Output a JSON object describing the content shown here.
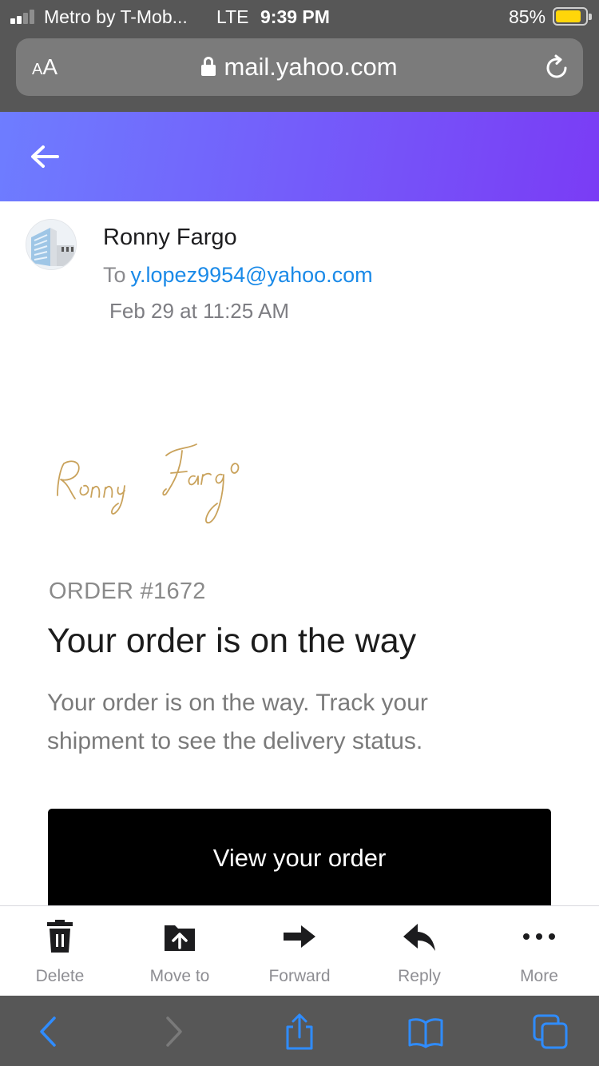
{
  "status_bar": {
    "carrier": "Metro by T-Mob...",
    "network": "LTE",
    "time": "9:39 PM",
    "battery_percent": "85%",
    "battery_level": 0.85,
    "signal_bars": 2
  },
  "address_bar": {
    "aa_small": "A",
    "aa_large": "A",
    "url": "mail.yahoo.com",
    "lock_icon": "lock-icon",
    "reload_icon": "reload-icon"
  },
  "header": {
    "back_icon": "back-arrow-icon",
    "gradient_start": "#6e7dff",
    "gradient_end": "#7a3cf5"
  },
  "email": {
    "sender_name": "Ronny Fargo",
    "to_label": "To",
    "to_address": "y.lopez9954@yahoo.com",
    "date": "Feb 29 at 11:25 AM",
    "signature_text": "Ronny Fargo",
    "order_number": "ORDER #1672",
    "title": "Your order is on the way",
    "body_line1": "Your order is on the way. Track your",
    "body_line2": "shipment to see the delivery status.",
    "button_label": "View your order"
  },
  "actions": [
    {
      "label": "Delete",
      "icon": "trash-icon"
    },
    {
      "label": "Move to",
      "icon": "move-to-folder-icon"
    },
    {
      "label": "Forward",
      "icon": "forward-arrow-icon"
    },
    {
      "label": "Reply",
      "icon": "reply-arrow-icon"
    },
    {
      "label": "More",
      "icon": "more-dots-icon"
    }
  ],
  "safari_toolbar": {
    "back": "back-chevron-icon",
    "forward": "forward-chevron-icon",
    "share": "share-icon",
    "bookmarks": "bookmarks-icon",
    "tabs": "tabs-icon",
    "accent_color": "#2f8cff"
  }
}
